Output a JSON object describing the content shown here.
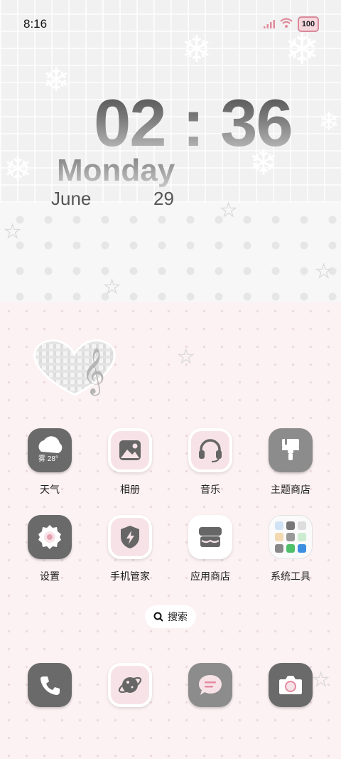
{
  "status_bar": {
    "time": "8:16",
    "battery": "100"
  },
  "clock": {
    "time": "02:36",
    "weekday": "Monday",
    "month": "June",
    "date": "29"
  },
  "apps": [
    {
      "label": "天气",
      "badge": "雾 28°",
      "icon": "weather-icon"
    },
    {
      "label": "相册",
      "icon": "gallery-icon"
    },
    {
      "label": "音乐",
      "icon": "headphones-icon"
    },
    {
      "label": "主题商店",
      "icon": "paint-brush-icon"
    },
    {
      "label": "设置",
      "icon": "gear-icon"
    },
    {
      "label": "手机管家",
      "icon": "shield-bolt-icon"
    },
    {
      "label": "应用商店",
      "icon": "store-icon"
    },
    {
      "label": "系统工具",
      "icon": "folder-icon"
    }
  ],
  "search": {
    "label": "搜索"
  },
  "dock": [
    {
      "icon": "phone-icon"
    },
    {
      "icon": "browser-planet-icon"
    },
    {
      "icon": "messages-icon"
    },
    {
      "icon": "camera-icon"
    }
  ],
  "colors": {
    "accent_pink": "#f7e3e7",
    "dark_icon": "#6a6a6a",
    "signal": "#e08a9c"
  }
}
